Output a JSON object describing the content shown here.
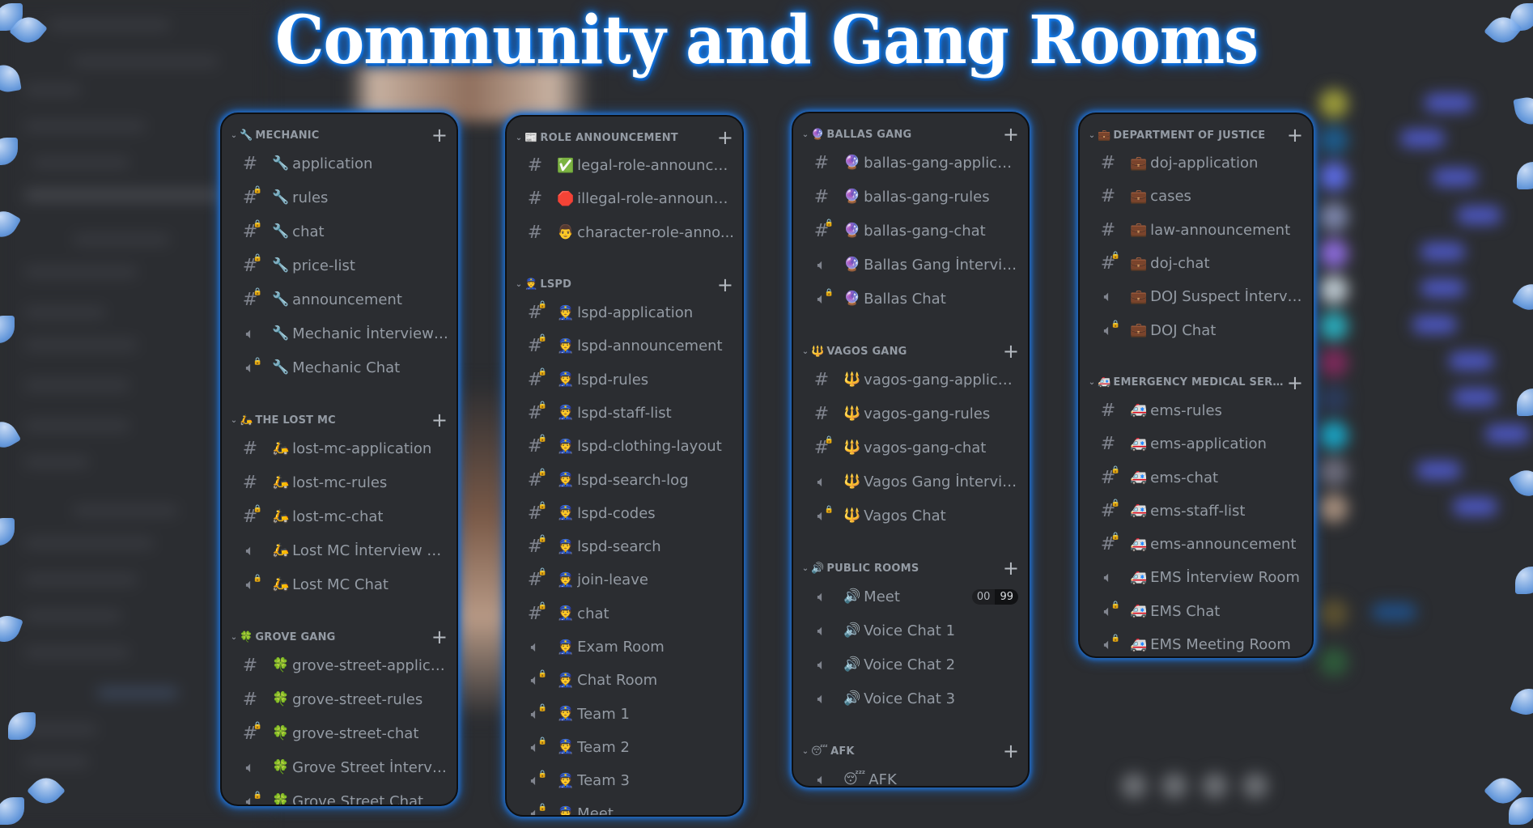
{
  "title": "Community and Gang Rooms",
  "icons": {
    "text_channel": "#",
    "locked_text_channel": "#🔒",
    "voice_channel": "🔊",
    "locked_voice_channel": "🔊🔒",
    "collapse": "⌄",
    "add": "+"
  },
  "panels": [
    {
      "categories": [
        {
          "name": "MECHANIC",
          "emoji": "🔧",
          "channels": [
            {
              "type": "text",
              "locked": false,
              "emoji": "🔧",
              "name": "application"
            },
            {
              "type": "text",
              "locked": true,
              "emoji": "🔧",
              "name": "rules"
            },
            {
              "type": "text",
              "locked": true,
              "emoji": "🔧",
              "name": "chat"
            },
            {
              "type": "text",
              "locked": true,
              "emoji": "🔧",
              "name": "price-list"
            },
            {
              "type": "text",
              "locked": true,
              "emoji": "🔧",
              "name": "announcement"
            },
            {
              "type": "voice",
              "locked": false,
              "emoji": "🔧",
              "name": "Mechanic İnterview R..."
            },
            {
              "type": "voice",
              "locked": true,
              "emoji": "🔧",
              "name": "Mechanic Chat"
            }
          ]
        },
        {
          "name": "THE LOST MC",
          "emoji": "🛵",
          "channels": [
            {
              "type": "text",
              "locked": false,
              "emoji": "🛵",
              "name": "lost-mc-application"
            },
            {
              "type": "text",
              "locked": false,
              "emoji": "🛵",
              "name": "lost-mc-rules"
            },
            {
              "type": "text",
              "locked": true,
              "emoji": "🛵",
              "name": "lost-mc-chat"
            },
            {
              "type": "voice",
              "locked": false,
              "emoji": "🛵",
              "name": "Lost MC İnterview Ro..."
            },
            {
              "type": "voice",
              "locked": true,
              "emoji": "🛵",
              "name": "Lost MC Chat"
            }
          ]
        },
        {
          "name": "GROVE GANG",
          "emoji": "🍀",
          "channels": [
            {
              "type": "text",
              "locked": false,
              "emoji": "🍀",
              "name": "grove-street-applica..."
            },
            {
              "type": "text",
              "locked": false,
              "emoji": "🍀",
              "name": "grove-street-rules"
            },
            {
              "type": "text",
              "locked": true,
              "emoji": "🍀",
              "name": "grove-street-chat"
            },
            {
              "type": "voice",
              "locked": false,
              "emoji": "🍀",
              "name": "Grove Street İntervie..."
            },
            {
              "type": "voice",
              "locked": true,
              "emoji": "🍀",
              "name": "Grove Street Chat"
            }
          ]
        }
      ]
    },
    {
      "categories": [
        {
          "name": "ROLE ANNOUNCEMENT",
          "emoji": "📰",
          "channels": [
            {
              "type": "text",
              "locked": false,
              "emoji": "✅",
              "name": "legal-role-announce..."
            },
            {
              "type": "text",
              "locked": false,
              "emoji": "🛑",
              "name": "illegal-role-announce..."
            },
            {
              "type": "text",
              "locked": false,
              "emoji": "👨",
              "name": "character-role-anno..."
            }
          ]
        },
        {
          "name": "LSPD",
          "emoji": "👮",
          "channels": [
            {
              "type": "text",
              "locked": true,
              "emoji": "👮",
              "name": "lspd-application"
            },
            {
              "type": "text",
              "locked": true,
              "emoji": "👮",
              "name": "lspd-announcement"
            },
            {
              "type": "text",
              "locked": true,
              "emoji": "👮",
              "name": "lspd-rules"
            },
            {
              "type": "text",
              "locked": true,
              "emoji": "👮",
              "name": "lspd-staff-list"
            },
            {
              "type": "text",
              "locked": true,
              "emoji": "👮",
              "name": "lspd-clothing-layout"
            },
            {
              "type": "text",
              "locked": true,
              "emoji": "👮",
              "name": "lspd-search-log"
            },
            {
              "type": "text",
              "locked": true,
              "emoji": "👮",
              "name": "lspd-codes"
            },
            {
              "type": "text",
              "locked": true,
              "emoji": "👮",
              "name": "lspd-search"
            },
            {
              "type": "text",
              "locked": true,
              "emoji": "👮",
              "name": "join-leave"
            },
            {
              "type": "text",
              "locked": true,
              "emoji": "👮",
              "name": "chat"
            },
            {
              "type": "voice",
              "locked": false,
              "emoji": "👮",
              "name": "Exam Room"
            },
            {
              "type": "voice",
              "locked": true,
              "emoji": "👮",
              "name": "Chat Room"
            },
            {
              "type": "voice",
              "locked": true,
              "emoji": "👮",
              "name": "Team 1"
            },
            {
              "type": "voice",
              "locked": true,
              "emoji": "👮",
              "name": "Team 2"
            },
            {
              "type": "voice",
              "locked": true,
              "emoji": "👮",
              "name": "Team 3"
            },
            {
              "type": "voice",
              "locked": true,
              "emoji": "👮",
              "name": "Meet"
            }
          ]
        }
      ]
    },
    {
      "categories": [
        {
          "name": "BALLAS GANG",
          "emoji": "🔮",
          "channels": [
            {
              "type": "text",
              "locked": false,
              "emoji": "🔮",
              "name": "ballas-gang-applicati..."
            },
            {
              "type": "text",
              "locked": false,
              "emoji": "🔮",
              "name": "ballas-gang-rules"
            },
            {
              "type": "text",
              "locked": true,
              "emoji": "🔮",
              "name": "ballas-gang-chat"
            },
            {
              "type": "voice",
              "locked": false,
              "emoji": "🔮",
              "name": "Ballas Gang İntervie..."
            },
            {
              "type": "voice",
              "locked": true,
              "emoji": "🔮",
              "name": "Ballas Chat"
            }
          ]
        },
        {
          "name": "VAGOS GANG",
          "emoji": "🔱",
          "channels": [
            {
              "type": "text",
              "locked": false,
              "emoji": "🔱",
              "name": "vagos-gang-applicati..."
            },
            {
              "type": "text",
              "locked": false,
              "emoji": "🔱",
              "name": "vagos-gang-rules"
            },
            {
              "type": "text",
              "locked": true,
              "emoji": "🔱",
              "name": "vagos-gang-chat"
            },
            {
              "type": "voice",
              "locked": false,
              "emoji": "🔱",
              "name": "Vagos Gang İnterview..."
            },
            {
              "type": "voice",
              "locked": true,
              "emoji": "🔱",
              "name": "Vagos Chat"
            }
          ]
        },
        {
          "name": "PUBLIC ROOMS",
          "emoji": "🔊",
          "channels": [
            {
              "type": "voice",
              "locked": false,
              "emoji": "🔊",
              "name": "Meet",
              "badge": [
                "00",
                "99"
              ]
            },
            {
              "type": "voice",
              "locked": false,
              "emoji": "🔊",
              "name": "Voice Chat 1"
            },
            {
              "type": "voice",
              "locked": false,
              "emoji": "🔊",
              "name": "Voice Chat 2"
            },
            {
              "type": "voice",
              "locked": false,
              "emoji": "🔊",
              "name": "Voice Chat 3"
            }
          ]
        },
        {
          "name": "AFK",
          "emoji": "😴",
          "channels": [
            {
              "type": "voice",
              "locked": false,
              "emoji": "😴",
              "name": "AFK"
            }
          ]
        }
      ]
    },
    {
      "categories": [
        {
          "name": "DEPARTMENT OF JUSTICE",
          "emoji": "💼",
          "channels": [
            {
              "type": "text",
              "locked": false,
              "emoji": "💼",
              "name": "doj-application"
            },
            {
              "type": "text",
              "locked": false,
              "emoji": "💼",
              "name": "cases"
            },
            {
              "type": "text",
              "locked": false,
              "emoji": "💼",
              "name": "law-announcement"
            },
            {
              "type": "text",
              "locked": true,
              "emoji": "💼",
              "name": "doj-chat"
            },
            {
              "type": "voice",
              "locked": false,
              "emoji": "💼",
              "name": "DOJ Suspect İntervie..."
            },
            {
              "type": "voice",
              "locked": true,
              "emoji": "💼",
              "name": "DOJ Chat"
            }
          ]
        },
        {
          "name": "EMERGENCY MEDICAL SERV...",
          "emoji": "🚑",
          "channels": [
            {
              "type": "text",
              "locked": false,
              "emoji": "🚑",
              "name": "ems-rules"
            },
            {
              "type": "text",
              "locked": false,
              "emoji": "🚑",
              "name": "ems-application"
            },
            {
              "type": "text",
              "locked": true,
              "emoji": "🚑",
              "name": "ems-chat"
            },
            {
              "type": "text",
              "locked": true,
              "emoji": "🚑",
              "name": "ems-staff-list"
            },
            {
              "type": "text",
              "locked": true,
              "emoji": "🚑",
              "name": "ems-announcement"
            },
            {
              "type": "voice",
              "locked": false,
              "emoji": "🚑",
              "name": "EMS İnterview Room"
            },
            {
              "type": "voice",
              "locked": true,
              "emoji": "🚑",
              "name": "EMS Chat"
            },
            {
              "type": "voice",
              "locked": true,
              "emoji": "🚑",
              "name": "EMS Meeting Room"
            }
          ]
        }
      ]
    }
  ],
  "colors": {
    "glow": "#1f6fd1",
    "panel_bg": "#2b2d31",
    "text": "#949ba4",
    "title": "#ffffff"
  }
}
